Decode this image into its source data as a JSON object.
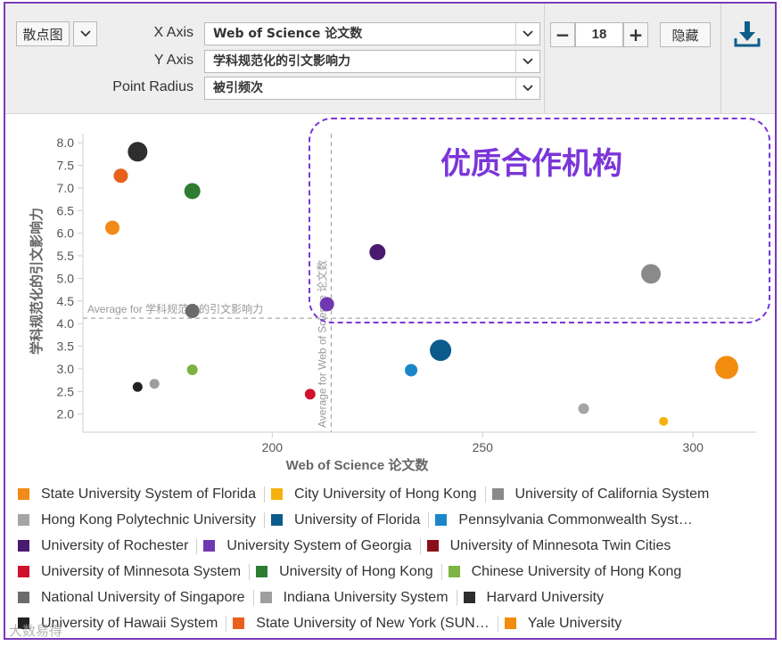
{
  "toolbar": {
    "chart_type_label": "散点图",
    "x_axis_label": "X Axis",
    "x_axis_value": "Web of Science 论文数",
    "y_axis_label": "Y Axis",
    "y_axis_value": "学科规范化的引文影响力",
    "radius_label": "Point Radius",
    "radius_value": "被引频次",
    "count_value": "18",
    "minus_label": "−",
    "plus_label": "+",
    "hide_label": "隐藏",
    "download_icon": "download-icon",
    "chevron_icon": "chevron-down-icon"
  },
  "annotation": {
    "text": "优质合作机构",
    "color": "#7b35d8"
  },
  "watermark": "大数易得",
  "chart_data": {
    "type": "scatter",
    "xlabel": "Web of Science 论文数",
    "ylabel": "学科规范化的引文影响力",
    "xlim": [
      155,
      315
    ],
    "ylim": [
      1.6,
      8.2
    ],
    "xticks": [
      200,
      250,
      300
    ],
    "yticks": [
      2.0,
      2.5,
      3.0,
      3.5,
      4.0,
      4.5,
      5.0,
      5.5,
      6.0,
      6.5,
      7.0,
      7.5,
      8.0
    ],
    "ytick_labels": [
      "2.0",
      "2.5",
      "3.0",
      "3.5",
      "4.0",
      "4.5",
      "5.0",
      "5.5",
      "6.0",
      "6.5",
      "7.0",
      "7.5",
      "8.0"
    ],
    "xtick_labels": [
      "200",
      "250",
      "300"
    ],
    "avg_x": 214,
    "avg_y": 4.12,
    "avg_x_label": "Average for Web of Science 论文数",
    "avg_y_label": "Average for 学科规范化的引文影响力",
    "radius_note": "relative radius from 被引频次",
    "points": [
      {
        "name": "Harvard University",
        "x": 168,
        "y": 7.8,
        "r": 11,
        "color": "#2e2e2e"
      },
      {
        "name": "State University of New York (SUN…",
        "x": 164,
        "y": 7.27,
        "r": 8,
        "color": "#e8611a"
      },
      {
        "name": "University of Hong Kong",
        "x": 181,
        "y": 6.93,
        "r": 9,
        "color": "#2e7d32"
      },
      {
        "name": "State University System of Florida",
        "x": 162,
        "y": 6.12,
        "r": 8,
        "color": "#f28a17"
      },
      {
        "name": "National University of Singapore",
        "x": 181,
        "y": 4.28,
        "r": 8,
        "color": "#6b6b6b"
      },
      {
        "name": "Chinese University of Hong Kong",
        "x": 181,
        "y": 2.98,
        "r": 6,
        "color": "#7cb342"
      },
      {
        "name": "University of Hawaii System",
        "x": 168,
        "y": 2.6,
        "r": 5.5,
        "color": "#222222"
      },
      {
        "name": "Indiana University System",
        "x": 172,
        "y": 2.67,
        "r": 5.5,
        "color": "#9e9e9e"
      },
      {
        "name": "University of Minnesota System",
        "x": 209,
        "y": 2.44,
        "r": 6,
        "color": "#d0112b"
      },
      {
        "name": "University System of Georgia",
        "x": 213,
        "y": 4.43,
        "r": 8,
        "color": "#7038b0"
      },
      {
        "name": "University of Rochester",
        "x": 225,
        "y": 5.58,
        "r": 9,
        "color": "#4a1a6e"
      },
      {
        "name": "University of Florida",
        "x": 240,
        "y": 3.41,
        "r": 12,
        "color": "#0b5a8c"
      },
      {
        "name": "Pennsylvania Commonwealth Syst…",
        "x": 233,
        "y": 2.97,
        "r": 7,
        "color": "#1a86c8"
      },
      {
        "name": "University of California System",
        "x": 290,
        "y": 5.1,
        "r": 11,
        "color": "#8a8a8a"
      },
      {
        "name": "Hong Kong Polytechnic University",
        "x": 274,
        "y": 2.12,
        "r": 6,
        "color": "#a5a5a5"
      },
      {
        "name": "Yale University",
        "x": 308,
        "y": 3.03,
        "r": 13,
        "color": "#f28c0f"
      },
      {
        "name": "City University of Hong Kong",
        "x": 293,
        "y": 1.84,
        "r": 5,
        "color": "#f5b20f"
      }
    ]
  },
  "legend": [
    [
      {
        "label": "State University System of Florida",
        "color": "#f28a17"
      },
      {
        "label": "City University of Hong Kong",
        "color": "#f5b20f"
      },
      {
        "label": "University of California System",
        "color": "#8a8a8a"
      }
    ],
    [
      {
        "label": "Hong Kong Polytechnic University",
        "color": "#a5a5a5"
      },
      {
        "label": "University of Florida",
        "color": "#0b5a8c"
      },
      {
        "label": "Pennsylvania Commonwealth Syst…",
        "color": "#1a86c8"
      }
    ],
    [
      {
        "label": "University of Rochester",
        "color": "#4a1a6e"
      },
      {
        "label": "University System of Georgia",
        "color": "#7038b0"
      },
      {
        "label": "University of Minnesota Twin Cities",
        "color": "#8b0f1a"
      }
    ],
    [
      {
        "label": "University of Minnesota System",
        "color": "#d0112b"
      },
      {
        "label": "University of Hong Kong",
        "color": "#2e7d32"
      },
      {
        "label": "Chinese University of Hong Kong",
        "color": "#7cb342"
      }
    ],
    [
      {
        "label": "National University of Singapore",
        "color": "#6b6b6b"
      },
      {
        "label": "Indiana University System",
        "color": "#9e9e9e"
      },
      {
        "label": "Harvard University",
        "color": "#2e2e2e"
      }
    ],
    [
      {
        "label": "University of Hawaii System",
        "color": "#222222"
      },
      {
        "label": "State University of New York (SUN…",
        "color": "#e8611a"
      },
      {
        "label": "Yale University",
        "color": "#f28c0f"
      }
    ]
  ]
}
